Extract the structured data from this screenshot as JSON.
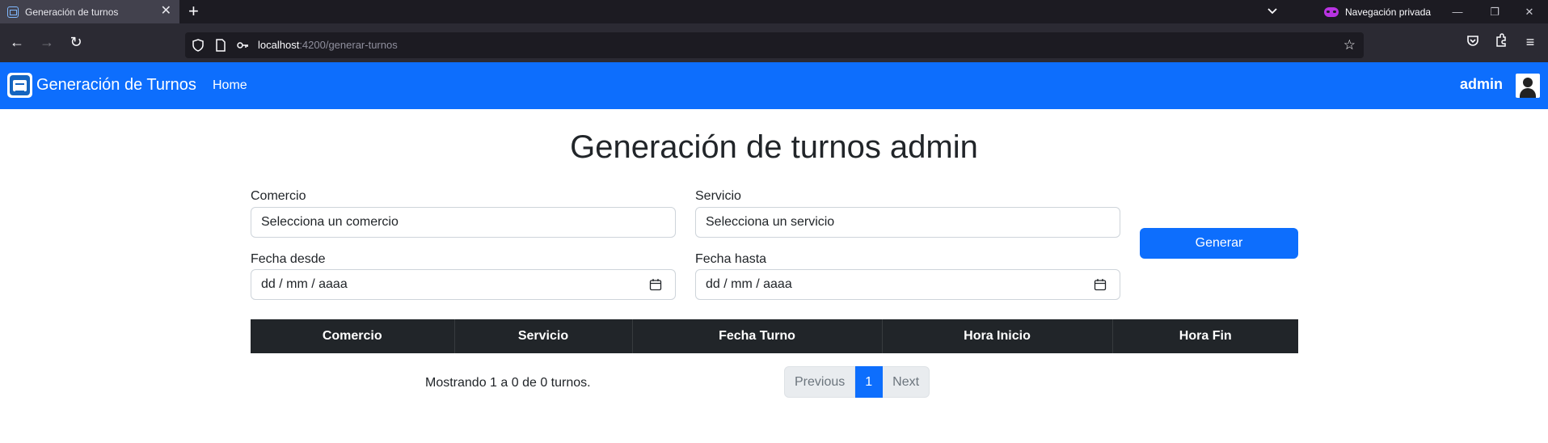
{
  "browser": {
    "tab_title": "Generación de turnos",
    "private_label": "Navegación privada",
    "url_host": "localhost",
    "url_path": ":4200/generar-turnos"
  },
  "app": {
    "brand": "Generación de Turnos",
    "nav_home": "Home",
    "user": "admin",
    "accent_color": "#0d6efd"
  },
  "page": {
    "title": "Generación de turnos admin"
  },
  "form": {
    "comercio_label": "Comercio",
    "comercio_value": "Selecciona un comercio",
    "servicio_label": "Servicio",
    "servicio_value": "Selecciona un servicio",
    "fecha_desde_label": "Fecha desde",
    "fecha_desde_placeholder": "dd / mm / aaaa",
    "fecha_hasta_label": "Fecha hasta",
    "fecha_hasta_placeholder": "dd / mm / aaaa",
    "generar_label": "Generar"
  },
  "table": {
    "headers": [
      "Comercio",
      "Servicio",
      "Fecha Turno",
      "Hora Inicio",
      "Hora Fin"
    ],
    "rows": []
  },
  "footer": {
    "showing_text": "Mostrando 1 a 0 de 0 turnos.",
    "prev_label": "Previous",
    "current_page": "1",
    "next_label": "Next"
  }
}
